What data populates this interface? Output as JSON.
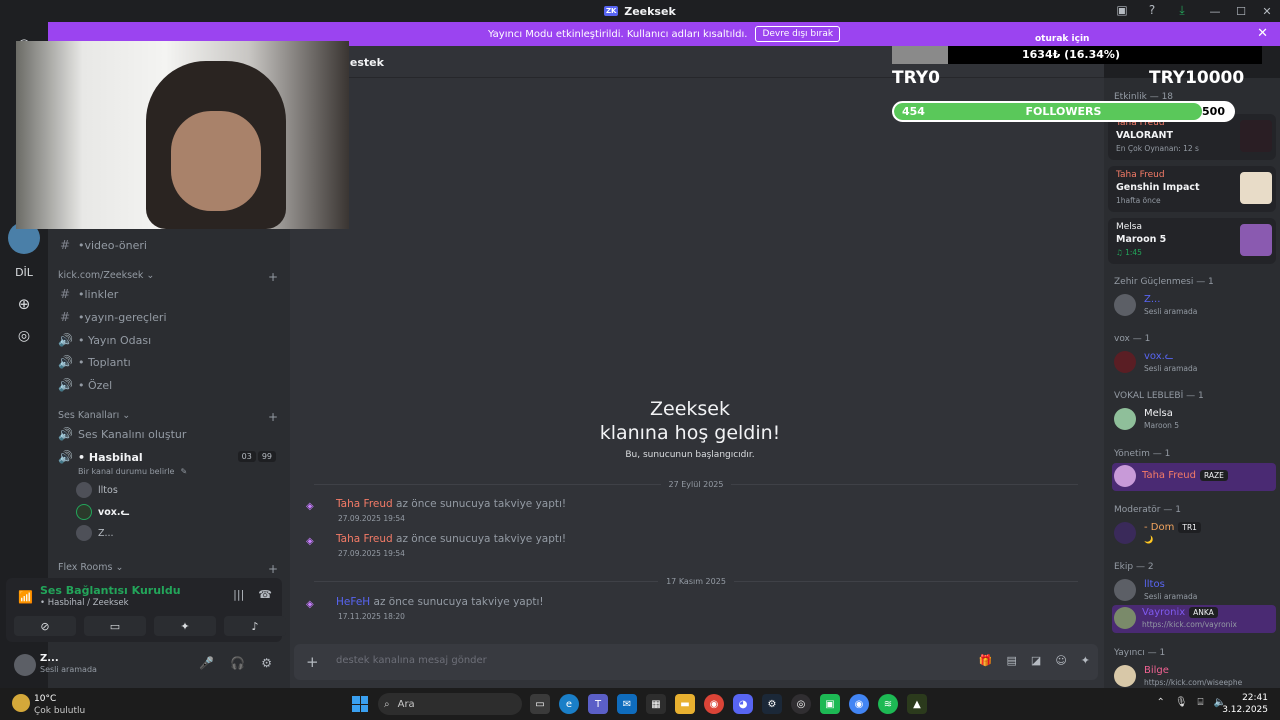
{
  "window": {
    "title": "Zeeksek",
    "logo_text": "ZK"
  },
  "banner": {
    "message": "Yayıncı Modu etkinleştirildi. Kullanıcı adları kısaltıldı.",
    "button": "Devre dışı bırak"
  },
  "servers": {
    "dil_label": "DİL"
  },
  "channels": {
    "ch_video": "•video-öneri",
    "cat_kick": "kick.com/Zeeksek ⌄",
    "ch_linkler": "•linkler",
    "ch_yayin_gerecleri": "•yayın-gereçleri",
    "ch_yayin_odasi": "• Yayın Odası",
    "ch_toplanti": "• Toplantı",
    "ch_ozel": "• Özel",
    "cat_ses": "Ses Kanalları ⌄",
    "ch_ses_olustur": "Ses Kanalını oluştur",
    "ch_hasbihal": "• Hasbihal",
    "hasbihal_status": "Bir kanal durumu belirle",
    "badge_a": "03",
    "badge_b": "99",
    "vc_users": [
      "lltos",
      "vox.ᓚ",
      "Z..."
    ],
    "cat_flex": "Flex Rooms ⌄"
  },
  "voice": {
    "status": "Ses Bağlantısı Kuruldu",
    "location": "• Hasbihal / Zeeksek"
  },
  "user": {
    "name": "Z...",
    "status": "Sesli aramada"
  },
  "chat": {
    "channel_name": "destek",
    "welcome_title": "Zeeksek",
    "welcome_line2": "klanına hoş geldin!",
    "welcome_sub": "Bu, sunucunun başlangıcıdır.",
    "date1": "27 Eylül 2025",
    "date2": "17 Kasım 2025",
    "messages": [
      {
        "user": "Taha Freud",
        "text": " az önce sunucuya takviye yaptı!",
        "date": "27.09.2025 19:54"
      },
      {
        "user": "Taha Freud",
        "text": " az önce sunucuya takviye yaptı!",
        "date": "27.09.2025 19:54"
      },
      {
        "user": "HeFeH",
        "text": " az önce sunucuya takviye yaptı!",
        "date": "17.11.2025 18:20"
      }
    ],
    "placeholder": "destek kanalına mesaj gönder"
  },
  "overlay": {
    "label": "oturak için",
    "progress_text": "1634₺ (16.34%)",
    "try_min": "TRY0",
    "try_max": "TRY10000",
    "followers_current": "454",
    "followers_label": "FOLLOWERS",
    "followers_goal": "500",
    "followers_fill": 0.908
  },
  "members": {
    "activity_header": "Etkinlik — 18",
    "activities": [
      {
        "name": "Taha Freud",
        "game": "VALORANT",
        "sub": "En Çok Oynanan: 12 s",
        "art": "#2a1e24"
      },
      {
        "name": "Taha Freud",
        "game": "Genshin Impact",
        "sub": "1hafta önce",
        "art": "#e8dcc8"
      },
      {
        "name": "Melsa",
        "game": "Maroon 5",
        "sub": "♫ 1:45",
        "art": "#8a5ab0"
      }
    ],
    "groups": [
      {
        "title": "Zehir Güçlenmesi — 1",
        "name": "Z...",
        "status": "Sesli aramada",
        "color": "#5865f2"
      },
      {
        "title": "vox — 1",
        "name": "vox.ᓚ",
        "status": "Sesli aramada",
        "color": "#5865f2"
      },
      {
        "title": "VOKAL LEBLEBİ — 1",
        "name": "Melsa",
        "status": "Maroon 5",
        "color": "#f2f3f5"
      },
      {
        "title": "Yönetim — 1",
        "name": "Taha Freud",
        "status": "",
        "tag": "RAZE",
        "color": "#f47b67"
      },
      {
        "title": "Moderatör — 1",
        "name": "- Dom",
        "status": "🌙",
        "tag": "TR1",
        "color": "#f0a35e"
      },
      {
        "title": "Ekip — 2",
        "name": "lltos",
        "status": "Sesli aramada",
        "color": "#5865f2"
      },
      {
        "title": "",
        "name": "Vayronix",
        "status": "https://kick.com/vayronix",
        "tag": "ANKA",
        "color": "#7f5af0"
      },
      {
        "title": "Yayıncı — 1",
        "name": "Bilge",
        "status": "https://kick.com/wiseephe",
        "color": "#f06292"
      }
    ]
  },
  "taskbar": {
    "temp": "10°C",
    "weather": "Çok bulutlu",
    "search": "Ara",
    "time": "22:41",
    "date": "3.12.2025"
  }
}
